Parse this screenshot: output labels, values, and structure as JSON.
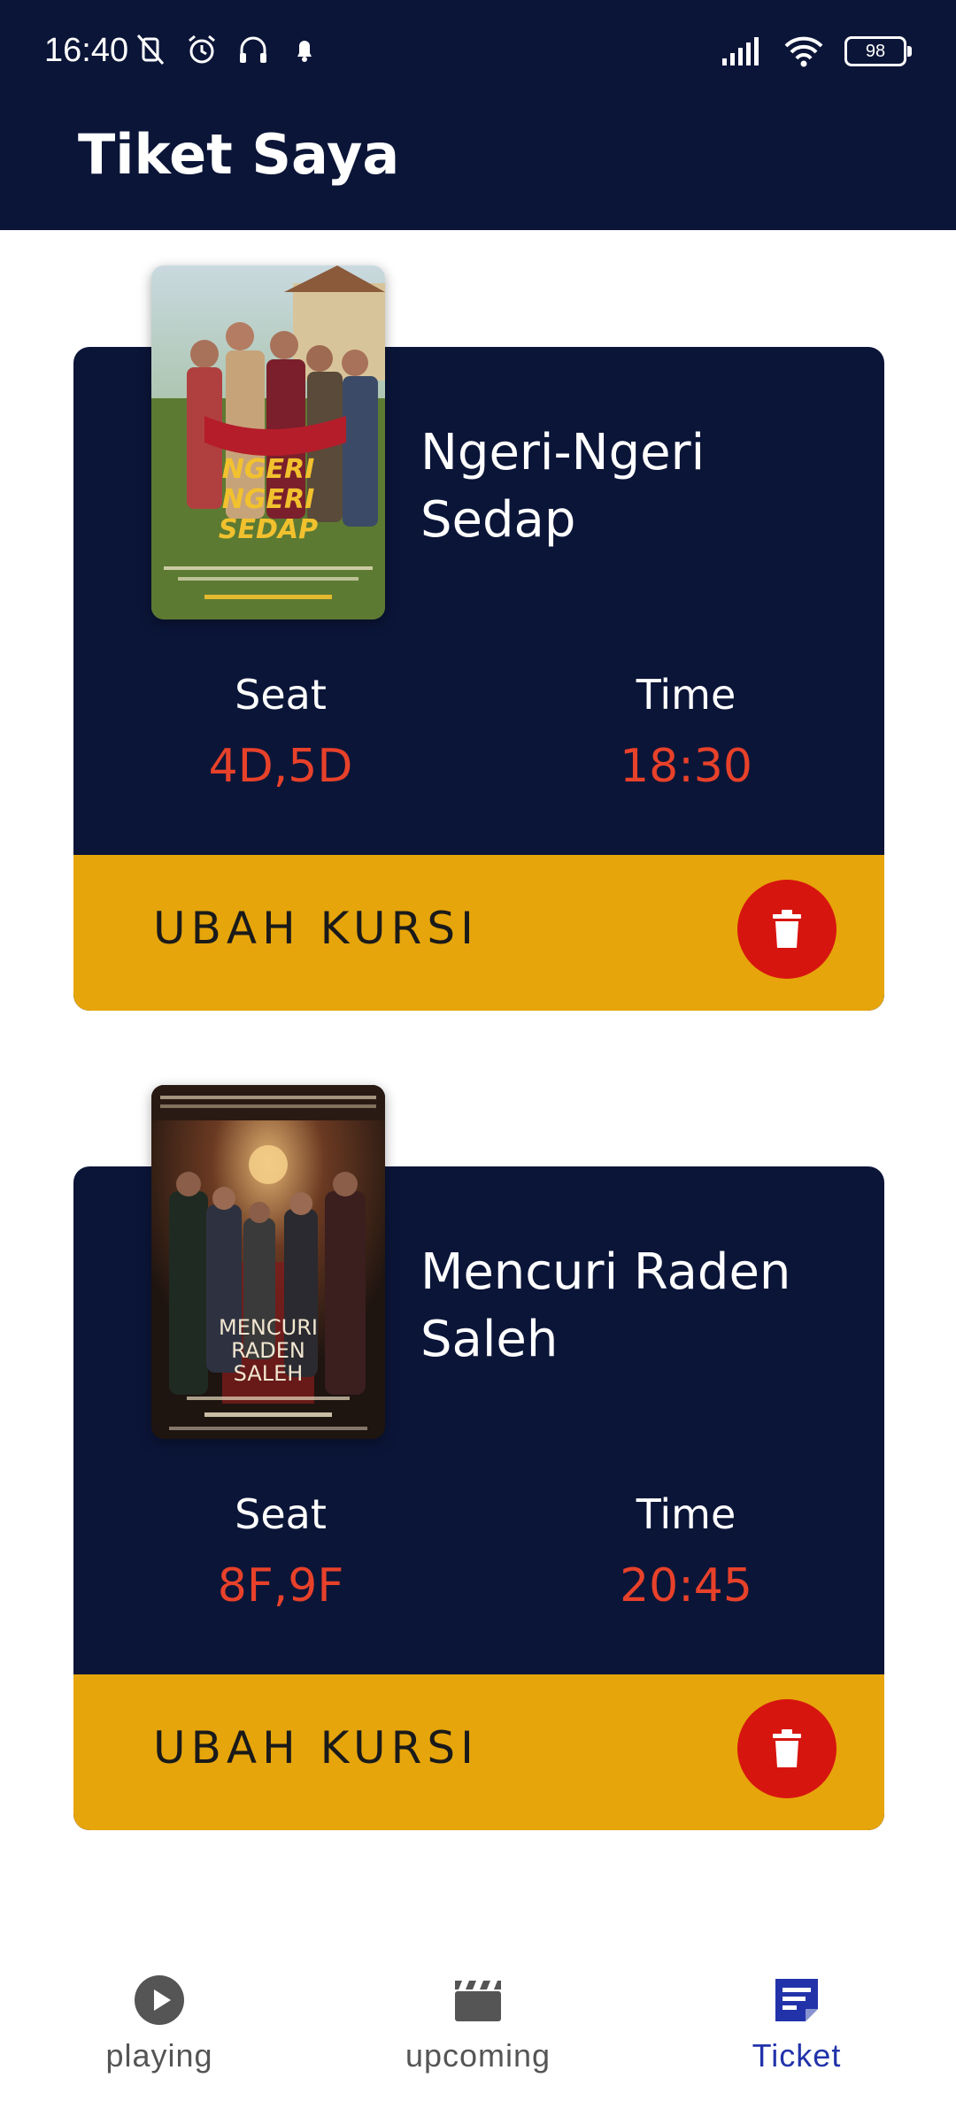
{
  "status_bar": {
    "time": "16:40",
    "battery": "98"
  },
  "app_bar": {
    "title": "Tiket Saya"
  },
  "tickets": [
    {
      "title_line1": "Ngeri-Ngeri",
      "title_line2": "Sedap",
      "seat_label": "Seat",
      "seat_value": "4D,5D",
      "time_label": "Time",
      "time_value": "18:30",
      "action_label": "UBAH KURSI"
    },
    {
      "title_line1": "Mencuri Raden",
      "title_line2": "Saleh",
      "seat_label": "Seat",
      "seat_value": "8F,9F",
      "time_label": "Time",
      "time_value": "20:45",
      "action_label": "UBAH KURSI"
    }
  ],
  "bottom_nav": {
    "items": [
      {
        "label": "playing",
        "icon": "play-circle-icon"
      },
      {
        "label": "upcoming",
        "icon": "clapperboard-icon"
      },
      {
        "label": "Ticket",
        "icon": "ticket-list-icon"
      }
    ],
    "active_index": 2
  },
  "colors": {
    "primary_dark": "#0b1538",
    "accent_yellow": "#e6a50a",
    "value_red": "#e8412a",
    "delete_red": "#d7150f",
    "active_nav": "#2233aa"
  }
}
